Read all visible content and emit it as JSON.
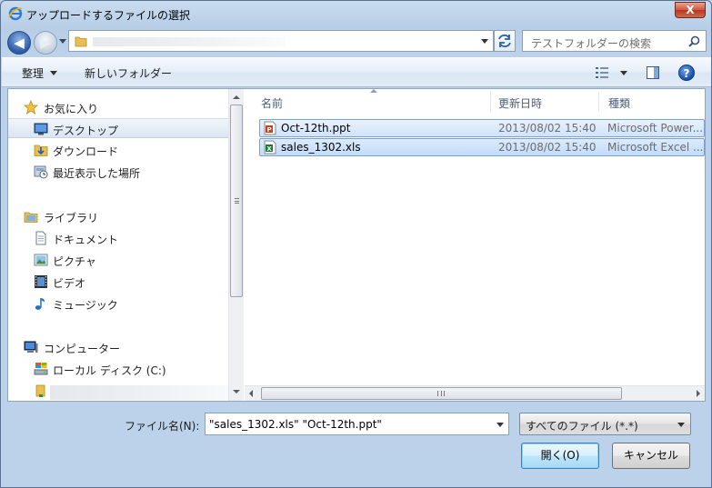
{
  "window": {
    "title": "アップロードするファイルの選択",
    "close_label": "X"
  },
  "address_bar": {
    "path_visible": ""
  },
  "search": {
    "placeholder": "テストフォルダーの検索"
  },
  "toolbar": {
    "organize_label": "整理",
    "new_folder_label": "新しいフォルダー",
    "help_label": "?"
  },
  "sidebar": {
    "favorites": {
      "label": "お気に入り",
      "items": [
        {
          "label": "デスクトップ",
          "icon": "desktop-icon",
          "selected": true
        },
        {
          "label": "ダウンロード",
          "icon": "download-folder-icon"
        },
        {
          "label": "最近表示した場所",
          "icon": "recent-places-icon"
        }
      ]
    },
    "libraries": {
      "label": "ライブラリ",
      "items": [
        {
          "label": "ドキュメント",
          "icon": "documents-icon"
        },
        {
          "label": "ピクチャ",
          "icon": "pictures-icon"
        },
        {
          "label": "ビデオ",
          "icon": "videos-icon"
        },
        {
          "label": "ミュージック",
          "icon": "music-icon"
        }
      ]
    },
    "computer": {
      "label": "コンピューター",
      "items": [
        {
          "label": "ローカル ディスク (C:)",
          "icon": "local-disk-icon"
        },
        {
          "label": "",
          "icon": "folder-icon"
        }
      ]
    }
  },
  "file_list": {
    "columns": [
      "名前",
      "更新日時",
      "種類"
    ],
    "files": [
      {
        "name": "Oct-12th.ppt",
        "modified": "2013/08/02 15:40",
        "type": "Microsoft Power...",
        "icon": "powerpoint-file-icon",
        "selected": true
      },
      {
        "name": "sales_1302.xls",
        "modified": "2013/08/02 15:40",
        "type": "Microsoft Excel ...",
        "icon": "excel-file-icon",
        "selected": true
      }
    ]
  },
  "bottom": {
    "filename_label": "ファイル名(N):",
    "filename_value": "\"sales_1302.xls\" \"Oct-12th.ppt\"",
    "filter_value": "すべてのファイル (*.*)",
    "open_label": "開く(O)",
    "cancel_label": "キャンセル"
  },
  "colors": {
    "frame": "#bcd2ea",
    "selection": "#cfe3fb",
    "selection_border": "#7da2ce",
    "ppt_icon": "#c8401e",
    "xls_icon": "#1e7a37"
  }
}
